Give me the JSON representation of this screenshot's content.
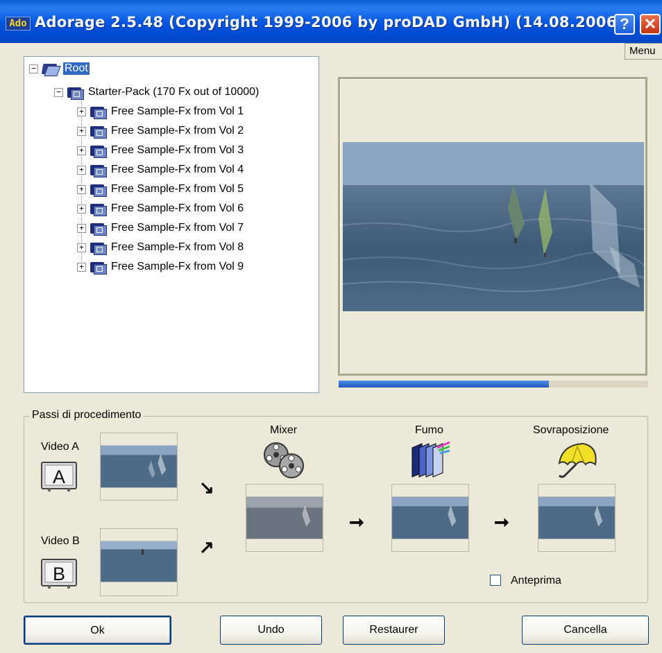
{
  "window": {
    "logo": "Ado",
    "title": "Adorage 2.5.48  (Copyright 1999-2006 by proDAD GmbH)  (14.08.2006)",
    "help_glyph": "?",
    "close_glyph": "✕",
    "menu_label": "Menu"
  },
  "tree": {
    "root_label": "Root",
    "pack_label": "Starter-Pack (170 Fx out of 10000)",
    "items": [
      "Free Sample-Fx from Vol 1",
      "Free Sample-Fx from Vol 2",
      "Free Sample-Fx from Vol 3",
      "Free Sample-Fx from Vol 4",
      "Free Sample-Fx from Vol 5",
      "Free Sample-Fx from Vol 6",
      "Free Sample-Fx from Vol 7",
      "Free Sample-Fx from Vol 8",
      "Free Sample-Fx from Vol 9"
    ],
    "expand_glyph": "+",
    "collapse_glyph": "−"
  },
  "preview": {
    "progress_fraction": 0.68
  },
  "steps": {
    "group_label": "Passi di procedimento",
    "video_a_label": "Video A",
    "video_a_letter": "A",
    "video_b_label": "Video B",
    "video_b_letter": "B",
    "mixer_label": "Mixer",
    "fumo_label": "Fumo",
    "overlay_label": "Sovraposizione",
    "anteprima_label": "Anteprima",
    "anteprima_checked": false,
    "arrow_down_glyph": "↘",
    "arrow_up_glyph": "↗",
    "arrow_right_glyph": "➞"
  },
  "buttons": {
    "ok": "Ok",
    "undo": "Undo",
    "restore": "Restaurer",
    "cancel": "Cancella"
  },
  "icons": {
    "mixer": "film-reels-icon",
    "fumo": "layered-frames-icon",
    "overlay": "umbrella-icon",
    "video_a": "tv-a-icon",
    "video_b": "tv-b-icon",
    "tree_folder": "folder-icon"
  },
  "colors": {
    "title_bar": "#0053e0",
    "selection": "#316ac5",
    "progress": "#2d6fd6",
    "window_bg": "#ece9d8"
  }
}
